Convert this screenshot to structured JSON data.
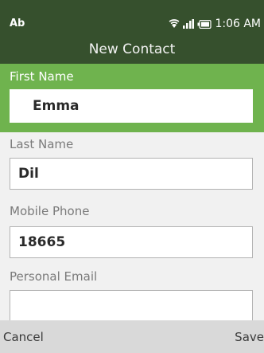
{
  "status_bar": {
    "carrier": "Ab",
    "time": "1:06 AM",
    "icons": [
      "wifi-icon",
      "signal-icon",
      "battery-icon"
    ]
  },
  "header": {
    "title": "New Contact"
  },
  "form": {
    "first_name": {
      "label": "First Name",
      "value": "Emma"
    },
    "last_name": {
      "label": "Last Name",
      "value": "Dil"
    },
    "mobile_phone": {
      "label": "Mobile  Phone",
      "value": "18665"
    },
    "personal_email": {
      "label": "Personal  Email",
      "value": ""
    }
  },
  "softkeys": {
    "left": "Cancel",
    "right": "Save"
  },
  "colors": {
    "header_bg": "#36502d",
    "active_field_bg": "#6fb34e",
    "softkey_bg": "#d9d9d9"
  }
}
